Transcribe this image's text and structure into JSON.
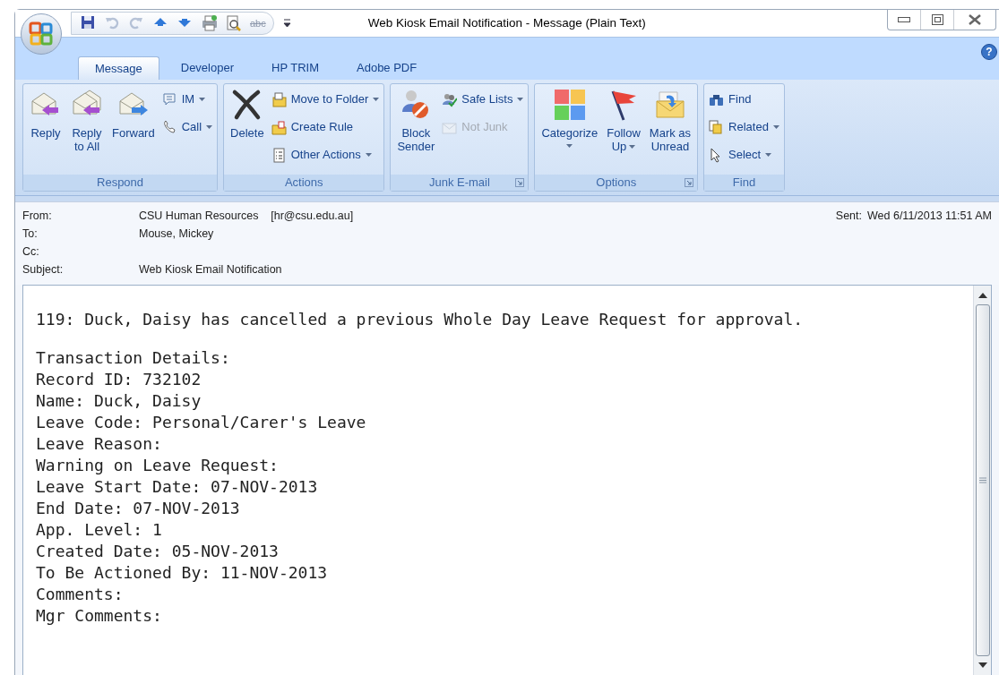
{
  "window": {
    "title": "Web Kiosk Email Notification - Message (Plain Text)"
  },
  "quick_access": [
    {
      "kind": "save"
    },
    {
      "kind": "undo",
      "disabled": true
    },
    {
      "kind": "redo",
      "disabled": true
    },
    {
      "kind": "up"
    },
    {
      "kind": "down"
    },
    {
      "kind": "print"
    },
    {
      "kind": "preview"
    },
    {
      "kind": "spelling",
      "text": "abc",
      "disabled": true
    },
    {
      "kind": "customize"
    }
  ],
  "tabs": [
    {
      "label": "Message",
      "selected": true
    },
    {
      "label": "Developer",
      "selected": false
    },
    {
      "label": "HP TRIM",
      "selected": false
    },
    {
      "label": "Adobe PDF",
      "selected": false
    }
  ],
  "help": "?",
  "ribbon": [
    {
      "label": "Respond",
      "launcher": false,
      "items": [
        {
          "kind": "large",
          "label": "Reply",
          "dropdown": false
        },
        {
          "kind": "large",
          "label": "Reply\nto All",
          "dropdown": false
        },
        {
          "kind": "large",
          "label": "Forward",
          "dropdown": false
        },
        {
          "kind": "small",
          "label": "IM",
          "dropdown": true,
          "disabled": false
        },
        {
          "kind": "small",
          "label": "Call",
          "dropdown": true,
          "disabled": false
        }
      ]
    },
    {
      "label": "Actions",
      "launcher": false,
      "items": [
        {
          "kind": "large",
          "label": "Delete",
          "dropdown": false
        },
        {
          "kind": "small",
          "label": "Move to Folder",
          "dropdown": true,
          "disabled": false
        },
        {
          "kind": "small",
          "label": "Create Rule",
          "dropdown": false,
          "disabled": false
        },
        {
          "kind": "small",
          "label": "Other Actions",
          "dropdown": true,
          "disabled": false
        }
      ]
    },
    {
      "label": "Junk E-mail",
      "launcher": true,
      "items": [
        {
          "kind": "large",
          "label": "Block\nSender",
          "dropdown": false
        },
        {
          "kind": "small",
          "label": "Safe Lists",
          "dropdown": true,
          "disabled": false
        },
        {
          "kind": "small",
          "label": "Not Junk",
          "dropdown": false,
          "disabled": true
        }
      ]
    },
    {
      "label": "Options",
      "launcher": true,
      "items": [
        {
          "kind": "large",
          "label": "Categorize",
          "dropdown": true
        },
        {
          "kind": "large",
          "label": "Follow\nUp",
          "dropdown": true
        },
        {
          "kind": "large",
          "label": "Mark as\nUnread",
          "dropdown": false
        }
      ]
    },
    {
      "label": "Find",
      "launcher": false,
      "items": [
        {
          "kind": "small",
          "label": "Find",
          "dropdown": false,
          "disabled": false
        },
        {
          "kind": "small",
          "label": "Related",
          "dropdown": true,
          "disabled": false
        },
        {
          "kind": "small",
          "label": "Select",
          "dropdown": true,
          "disabled": false
        }
      ]
    }
  ],
  "header": {
    "fields": [
      {
        "label": "From:",
        "value": "CSU Human Resources    [hr@csu.edu.au]"
      },
      {
        "label": "To:",
        "value": "Mouse, Mickey"
      },
      {
        "label": "Cc:"
      },
      {
        "label": "Subject:",
        "value": "Web Kiosk Email Notification"
      }
    ],
    "sent": {
      "label": "Sent:",
      "value": "Wed 6/11/2013 11:51 AM"
    }
  },
  "body": [
    [
      "119: Duck, Daisy has cancelled a previous Whole Day Leave Request for approval."
    ],
    [
      "Transaction Details:",
      "Record ID: 732102",
      "Name: Duck, Daisy",
      "Leave Code: Personal/Carer's Leave",
      "Leave Reason:",
      "Warning on Leave Request:",
      "Leave Start Date: 07-NOV-2013",
      "End Date: 07-NOV-2013",
      "App. Level: 1",
      "Created Date: 05-NOV-2013",
      "To Be Actioned By: 11-NOV-2013",
      "Comments:",
      "Mgr Comments:"
    ]
  ]
}
